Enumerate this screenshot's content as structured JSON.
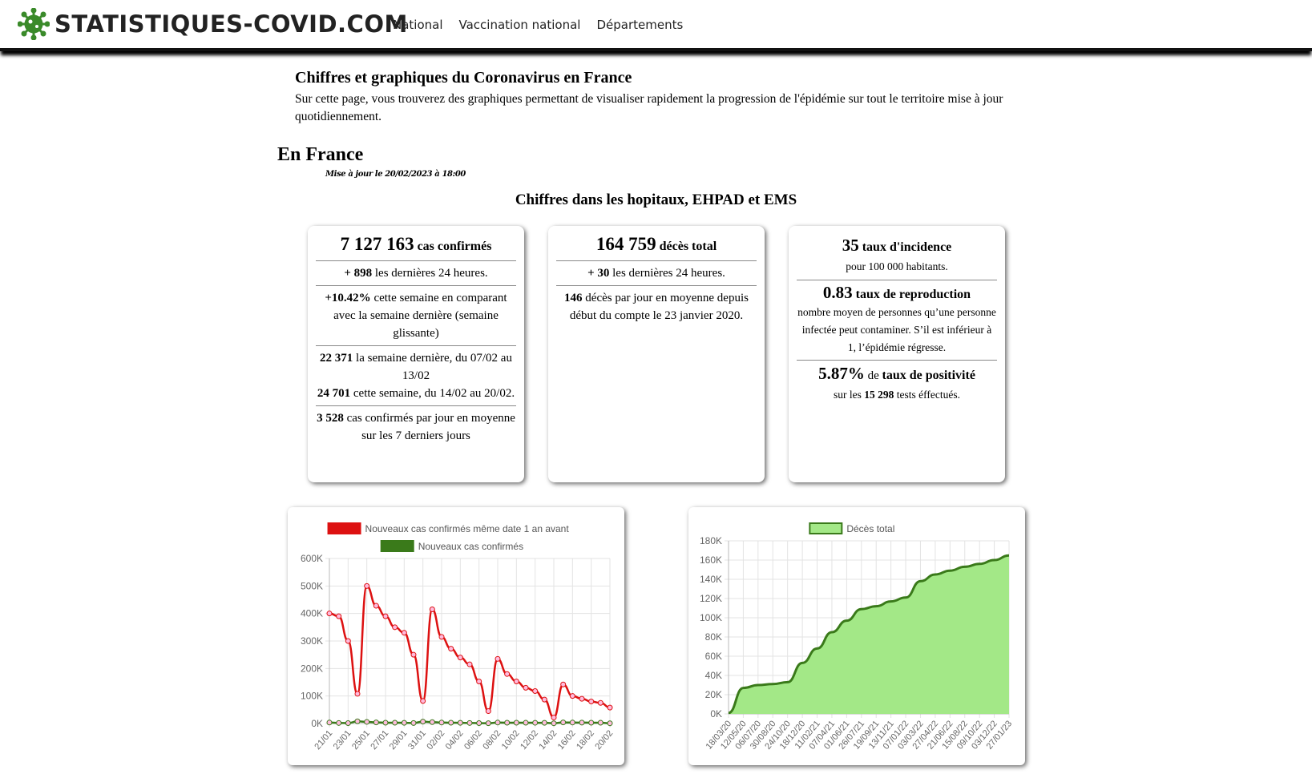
{
  "header": {
    "site_title": "STATISTIQUES-COVID.COM",
    "nav": [
      "National",
      "Vaccination national",
      "Départements"
    ]
  },
  "intro": {
    "title": "Chiffres et graphiques du Coronavirus en France",
    "text": "Sur cette page, vous trouverez des graphiques permettant de visualiser rapidement la progression de l'épidémie sur tout le territoire mise à jour quotidiennement."
  },
  "france": {
    "heading": "En France",
    "updated": "Mise à jour le 20/02/2023 à 18:00",
    "section_title": "Chiffres dans les hopitaux, EHPAD et EMS"
  },
  "cards": {
    "cases": {
      "total": "7 127 163",
      "total_label": " cas confirmés",
      "last24_value": "+ 898",
      "last24_label": " les dernières 24 heures.",
      "week_change": "+10.42%",
      "week_change_label": " cette semaine en comparant avec la semaine dernière (semaine glissante)",
      "last_week_value": "22 371",
      "last_week_label": " la semaine dernière, du 07/02 au 13/02",
      "this_week_value": "24 701",
      "this_week_label": " cette semaine, du 14/02 au 20/02.",
      "avg_value": "3 528",
      "avg_label": " cas confirmés par jour en moyenne sur les 7 derniers jours"
    },
    "deaths": {
      "total": "164 759",
      "total_label": " décès total",
      "last24_value": "+ 30",
      "last24_label": " les dernières 24 heures.",
      "avg_value": "146",
      "avg_label": " décès par jour en moyenne depuis début du compte le 23 janvier 2020."
    },
    "rates": {
      "incidence_value": "35",
      "incidence_label": " taux d'incidence",
      "incidence_sub": "pour 100 000 habitants.",
      "r_value": "0.83",
      "r_label": " taux de reproduction",
      "r_sub": "nombre moyen de personnes qu’une personne infectée peut contaminer. S’il est inférieur à 1, l’épidémie régresse.",
      "positivity_value": "5.87%",
      "positivity_mid": " de ",
      "positivity_label": "taux de positivité",
      "positivity_sub_pre": "sur les ",
      "tests_value": "15 298",
      "positivity_sub_post": " tests éffectués."
    }
  },
  "chart_data": [
    {
      "type": "line",
      "categories": [
        "21/01",
        "22/01",
        "23/01",
        "24/01",
        "25/01",
        "26/01",
        "27/01",
        "28/01",
        "29/01",
        "30/01",
        "31/01",
        "01/02",
        "02/02",
        "03/02",
        "04/02",
        "05/02",
        "06/02",
        "07/02",
        "08/02",
        "09/02",
        "10/02",
        "11/02",
        "12/02",
        "13/02",
        "14/02",
        "15/02",
        "16/02",
        "17/02",
        "18/02",
        "19/02",
        "20/02"
      ],
      "x_tick_labels": [
        "21/01",
        "23/01",
        "25/01",
        "27/01",
        "29/01",
        "31/01",
        "02/02",
        "04/02",
        "06/02",
        "08/02",
        "10/02",
        "12/02",
        "14/02",
        "16/02",
        "18/02",
        "20/02"
      ],
      "series": [
        {
          "name": "Nouveaux cas confirmés même date 1 an avant",
          "color": "#dd1111",
          "values": [
            400000,
            390000,
            300000,
            108000,
            500000,
            428000,
            390000,
            350000,
            330000,
            250000,
            82000,
            415000,
            315000,
            272000,
            240000,
            215000,
            153000,
            45000,
            235000,
            180000,
            153000,
            130000,
            118000,
            87000,
            22000,
            142000,
            100000,
            90000,
            80000,
            75000,
            58000
          ]
        },
        {
          "name": "Nouveaux cas confirmés",
          "color": "#3a7a1a",
          "values": [
            3500,
            2000,
            1500,
            8000,
            6000,
            4000,
            3000,
            3000,
            2500,
            1800,
            7000,
            5000,
            3500,
            3000,
            2500,
            2000,
            1500,
            1000,
            3500,
            3000,
            3000,
            2800,
            2700,
            2500,
            900,
            4000,
            3500,
            3200,
            3000,
            2800,
            900
          ]
        }
      ],
      "ylim": [
        0,
        600000
      ],
      "y_ticks": [
        "0K",
        "100K",
        "200K",
        "300K",
        "400K",
        "500K",
        "600K"
      ],
      "legend": "top"
    },
    {
      "type": "area",
      "x_tick_labels": [
        "18/03/20",
        "12/05/20",
        "06/07/20",
        "30/08/20",
        "24/10/20",
        "18/12/20",
        "11/02/21",
        "07/04/21",
        "01/06/21",
        "26/07/21",
        "19/09/21",
        "13/11/21",
        "07/01/22",
        "03/03/22",
        "27/04/22",
        "21/06/22",
        "15/08/22",
        "09/10/22",
        "03/12/22",
        "27/01/23"
      ],
      "series": [
        {
          "name": "Décès total",
          "color": "#a3e887",
          "line_color": "#3a7a1a",
          "values": [
            1000,
            27000,
            30000,
            31000,
            33000,
            53000,
            68000,
            85000,
            97000,
            109000,
            112000,
            117000,
            121000,
            138000,
            145000,
            149000,
            153000,
            156000,
            160000,
            164759
          ]
        }
      ],
      "ylim": [
        0,
        180000
      ],
      "y_ticks": [
        "0K",
        "20K",
        "40K",
        "60K",
        "80K",
        "100K",
        "120K",
        "140K",
        "160K",
        "180K"
      ],
      "legend": "top"
    }
  ]
}
